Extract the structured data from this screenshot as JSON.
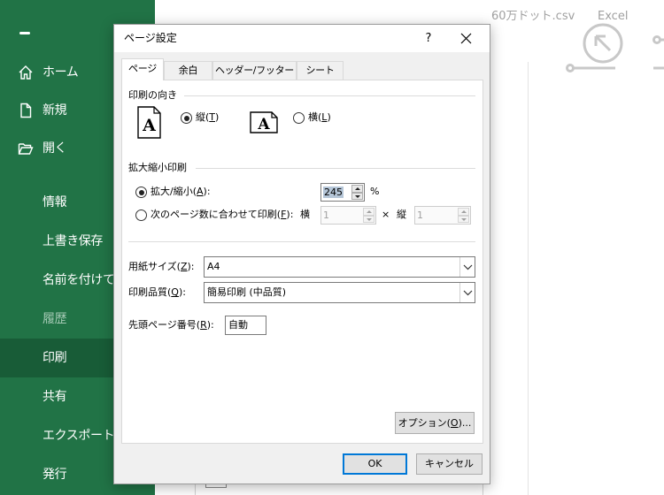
{
  "window": {
    "file_name": "60万ドット.csv",
    "app_name": "Excel"
  },
  "colors": {
    "sidebar": "#217346",
    "sidebar_selected": "#185c37",
    "sidebar_disabled_text": "#a3c8b3",
    "default_button_border": "#0078d7",
    "annotation": "#ff0000"
  },
  "sidebar": {
    "back_icon": "back-arrow-icon",
    "items": [
      {
        "label": "ホーム",
        "icon": "home-icon"
      },
      {
        "label": "新規",
        "icon": "new-document-icon"
      },
      {
        "label": "開く",
        "icon": "open-folder-icon"
      },
      {
        "label": "情報"
      },
      {
        "label": "上書き保存"
      },
      {
        "label": "名前を付けて"
      },
      {
        "label": "履歴",
        "disabled": true
      },
      {
        "label": "印刷",
        "selected": true
      },
      {
        "label": "共有"
      },
      {
        "label": "エクスポート"
      },
      {
        "label": "発行"
      }
    ]
  },
  "dialog": {
    "title": "ページ設定",
    "help_label": "?",
    "close_icon": "close-icon",
    "tabs": [
      {
        "label": "ページ",
        "active": true
      },
      {
        "label": "余白"
      },
      {
        "label": "ヘッダー/フッター"
      },
      {
        "label": "シート"
      }
    ],
    "orientation": {
      "section_label": "印刷の向き",
      "portrait": {
        "label": "縦(T)",
        "icon_letter": "A",
        "checked": true
      },
      "landscape": {
        "label": "横(L)",
        "icon_letter": "A",
        "checked": false
      }
    },
    "scaling": {
      "section_label": "拡大縮小印刷",
      "adjust": {
        "label": "拡大/縮小(A):",
        "value": "245",
        "unit": "%",
        "checked": true
      },
      "fit": {
        "label": "次のページ数に合わせて印刷(F):",
        "checked": false,
        "wide_label": "横",
        "wide_value": "1",
        "times": "×",
        "tall_label": "縦",
        "tall_value": "1"
      }
    },
    "paper_size": {
      "label": "用紙サイズ(Z):",
      "value": "A4"
    },
    "print_quality": {
      "label": "印刷品質(Q):",
      "value": "簡易印刷 (中品質)"
    },
    "first_page_number": {
      "label": "先頭ページ番号(R):",
      "value": "自動"
    },
    "options_button": "オプション(O)...",
    "ok_button": "OK",
    "cancel_button": "キャンセル"
  }
}
